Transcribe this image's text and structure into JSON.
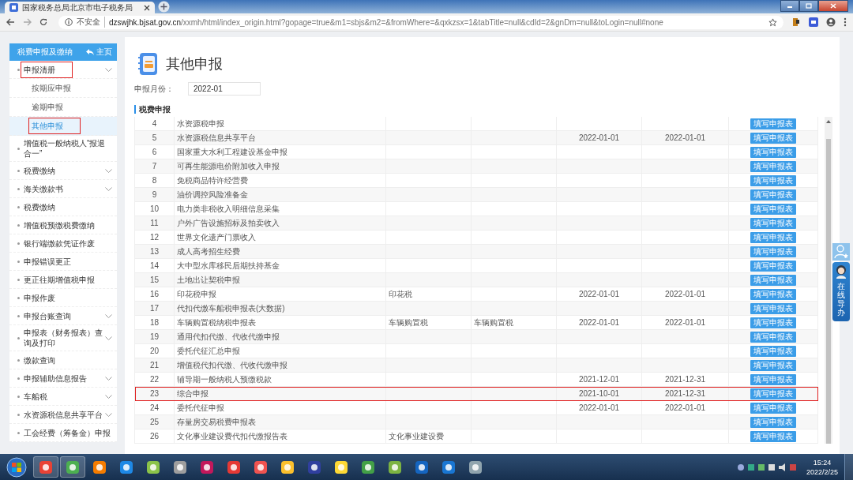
{
  "browser": {
    "tab_title": "国家税务总局北京市电子税务局",
    "security_label": "不安全",
    "url_host": "dzswjhk.bjsat.gov.cn",
    "url_path": "/xxmh/html/index_origin.html?gopage=true&m1=sbjs&m2=&fromWhere=&qxkzsx=1&tabTitle=null&cdId=2&gnDm=null&toLogin=null#none"
  },
  "sidebar": {
    "title": "税费申报及缴纳",
    "home_label": "主页",
    "items": [
      {
        "label": "申报清册",
        "kind": "group",
        "marked": true,
        "children": [
          {
            "label": "按期应申报",
            "selected": false,
            "marked": false
          },
          {
            "label": "逾期申报",
            "selected": false,
            "marked": false
          },
          {
            "label": "其他申报",
            "selected": true,
            "marked": true
          }
        ]
      },
      {
        "label": "增值税一般纳税人“报退合一”",
        "kind": "link",
        "marked": false
      },
      {
        "label": "税费缴纳",
        "kind": "group",
        "marked": false
      },
      {
        "label": "海关缴款书",
        "kind": "group",
        "marked": false
      },
      {
        "label": "税费缴纳",
        "kind": "link",
        "marked": false
      },
      {
        "label": "增值税预缴税费缴纳",
        "kind": "link",
        "marked": false
      },
      {
        "label": "银行端缴款凭证作废",
        "kind": "link",
        "marked": false
      },
      {
        "label": "申报错误更正",
        "kind": "link",
        "marked": false
      },
      {
        "label": "更正往期增值税申报",
        "kind": "link",
        "marked": false
      },
      {
        "label": "申报作废",
        "kind": "link",
        "marked": false
      },
      {
        "label": "申报台账查询",
        "kind": "group",
        "marked": false
      },
      {
        "label": "申报表（财务报表）查询及打印",
        "kind": "group",
        "marked": false
      },
      {
        "label": "缴款查询",
        "kind": "link",
        "marked": false
      },
      {
        "label": "申报辅助信息报告",
        "kind": "group",
        "marked": false
      },
      {
        "label": "车船税",
        "kind": "group",
        "marked": false
      },
      {
        "label": "水资源税信息共享平台",
        "kind": "group",
        "marked": false
      },
      {
        "label": "工会经费（筹备金）申报",
        "kind": "link",
        "marked": false
      }
    ]
  },
  "page": {
    "title": "其他申报",
    "month_label": "申报月份：",
    "month_value": "2022-01",
    "section_title": "税费申报"
  },
  "table": {
    "rows": [
      {
        "no": "4",
        "name": "水资源税申报",
        "action": "填写申报表",
        "marked": false
      },
      {
        "no": "5",
        "name": "水资源税信息共享平台",
        "start": "2022-01-01",
        "end": "2022-01-01",
        "action": "填写申报表",
        "marked": false
      },
      {
        "no": "6",
        "name": "国家重大水利工程建设基金申报",
        "action": "填写申报表",
        "marked": false
      },
      {
        "no": "7",
        "name": "可再生能源电价附加收入申报",
        "action": "填写申报表",
        "marked": false
      },
      {
        "no": "8",
        "name": "免税商品特许经营费",
        "action": "填写申报表",
        "marked": false
      },
      {
        "no": "9",
        "name": "油价调控风险准备金",
        "action": "填写申报表",
        "marked": false
      },
      {
        "no": "10",
        "name": "电力类非税收入明细信息采集",
        "action": "填写申报表",
        "marked": false
      },
      {
        "no": "11",
        "name": "户外广告设施招标及拍卖收入",
        "action": "填写申报表",
        "marked": false
      },
      {
        "no": "12",
        "name": "世界文化遗产门票收入",
        "action": "填写申报表",
        "marked": false
      },
      {
        "no": "13",
        "name": "成人高考招生经费",
        "action": "填写申报表",
        "marked": false
      },
      {
        "no": "14",
        "name": "大中型水库移民后期扶持基金",
        "action": "填写申报表",
        "marked": false
      },
      {
        "no": "15",
        "name": "土地出让契税申报",
        "action": "填写申报表",
        "marked": false
      },
      {
        "no": "16",
        "name": "印花税申报",
        "column_3": "印花税",
        "start": "2022-01-01",
        "end": "2022-01-01",
        "action": "填写申报表",
        "marked": false
      },
      {
        "no": "17",
        "name": "代扣代缴车船税申报表(大数据)",
        "action": "填写申报表",
        "marked": false
      },
      {
        "no": "18",
        "name": "车辆购置税纳税申报表",
        "column_3": "车辆购置税",
        "column_4": "车辆购置税",
        "start": "2022-01-01",
        "end": "2022-01-01",
        "action": "填写申报表",
        "marked": false
      },
      {
        "no": "19",
        "name": "通用代扣代缴、代收代缴申报",
        "action": "填写申报表",
        "marked": false
      },
      {
        "no": "20",
        "name": "委托代征汇总申报",
        "action": "填写申报表",
        "marked": false
      },
      {
        "no": "21",
        "name": "增值税代扣代缴、代收代缴申报",
        "action": "填写申报表",
        "marked": false
      },
      {
        "no": "22",
        "name": "辅导期一般纳税人预缴税款",
        "start": "2021-12-01",
        "end": "2021-12-31",
        "action": "填写申报表",
        "marked": false
      },
      {
        "no": "23",
        "name": "综合申报",
        "start": "2021-10-01",
        "end": "2021-12-31",
        "action": "填写申报表",
        "marked": true
      },
      {
        "no": "24",
        "name": "委托代征申报",
        "start": "2022-01-01",
        "end": "2022-01-01",
        "action": "填写申报表",
        "marked": false
      },
      {
        "no": "25",
        "name": "存量房交易税费申报表",
        "action": "填写申报表",
        "marked": false
      },
      {
        "no": "26",
        "name": "文化事业建设费代扣代缴报告表",
        "column_3": "文化事业建设费",
        "action": "填写申报表",
        "marked": false
      }
    ]
  },
  "helper": {
    "label": "在线导办"
  },
  "taskbar": {
    "time": "15:24",
    "date": "2022/2/25"
  }
}
